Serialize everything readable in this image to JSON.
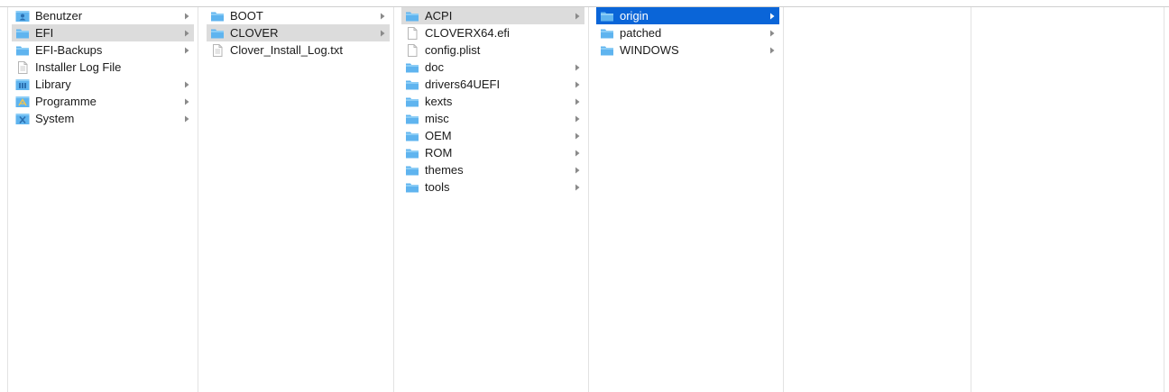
{
  "columns": [
    {
      "items": [
        {
          "label": "Benutzer",
          "icon": "users-folder-icon",
          "children": true,
          "state": "normal"
        },
        {
          "label": "EFI",
          "icon": "folder-icon",
          "children": true,
          "state": "path"
        },
        {
          "label": "EFI-Backups",
          "icon": "folder-icon",
          "children": true,
          "state": "normal"
        },
        {
          "label": "Installer Log File",
          "icon": "document-icon",
          "children": false,
          "state": "normal"
        },
        {
          "label": "Library",
          "icon": "library-folder-icon",
          "children": true,
          "state": "normal"
        },
        {
          "label": "Programme",
          "icon": "applications-folder-icon",
          "children": true,
          "state": "normal"
        },
        {
          "label": "System",
          "icon": "system-folder-icon",
          "children": true,
          "state": "normal"
        }
      ]
    },
    {
      "items": [
        {
          "label": "BOOT",
          "icon": "folder-icon",
          "children": true,
          "state": "normal"
        },
        {
          "label": "CLOVER",
          "icon": "folder-icon",
          "children": true,
          "state": "path"
        },
        {
          "label": "Clover_Install_Log.txt",
          "icon": "document-icon",
          "children": false,
          "state": "normal"
        }
      ]
    },
    {
      "items": [
        {
          "label": "ACPI",
          "icon": "folder-icon",
          "children": true,
          "state": "path"
        },
        {
          "label": "CLOVERX64.efi",
          "icon": "blank-file-icon",
          "children": false,
          "state": "normal"
        },
        {
          "label": "config.plist",
          "icon": "blank-file-icon",
          "children": false,
          "state": "normal"
        },
        {
          "label": "doc",
          "icon": "folder-icon",
          "children": true,
          "state": "normal"
        },
        {
          "label": "drivers64UEFI",
          "icon": "folder-icon",
          "children": true,
          "state": "normal"
        },
        {
          "label": "kexts",
          "icon": "folder-icon",
          "children": true,
          "state": "normal"
        },
        {
          "label": "misc",
          "icon": "folder-icon",
          "children": true,
          "state": "normal"
        },
        {
          "label": "OEM",
          "icon": "folder-icon",
          "children": true,
          "state": "normal"
        },
        {
          "label": "ROM",
          "icon": "folder-icon",
          "children": true,
          "state": "normal"
        },
        {
          "label": "themes",
          "icon": "folder-icon",
          "children": true,
          "state": "normal"
        },
        {
          "label": "tools",
          "icon": "folder-icon",
          "children": true,
          "state": "normal"
        }
      ]
    },
    {
      "items": [
        {
          "label": "origin",
          "icon": "folder-icon",
          "children": true,
          "state": "selected"
        },
        {
          "label": "patched",
          "icon": "folder-icon",
          "children": true,
          "state": "normal"
        },
        {
          "label": "WINDOWS",
          "icon": "folder-icon",
          "children": true,
          "state": "normal"
        }
      ]
    },
    {
      "items": []
    },
    {
      "items": []
    }
  ],
  "colors": {
    "folder": "#5fb4ef",
    "folder_tab": "#8ccdf6",
    "selected_row": "#0a65d8",
    "path_row": "#dcdcdc",
    "chevron": "#8a8a8a"
  }
}
